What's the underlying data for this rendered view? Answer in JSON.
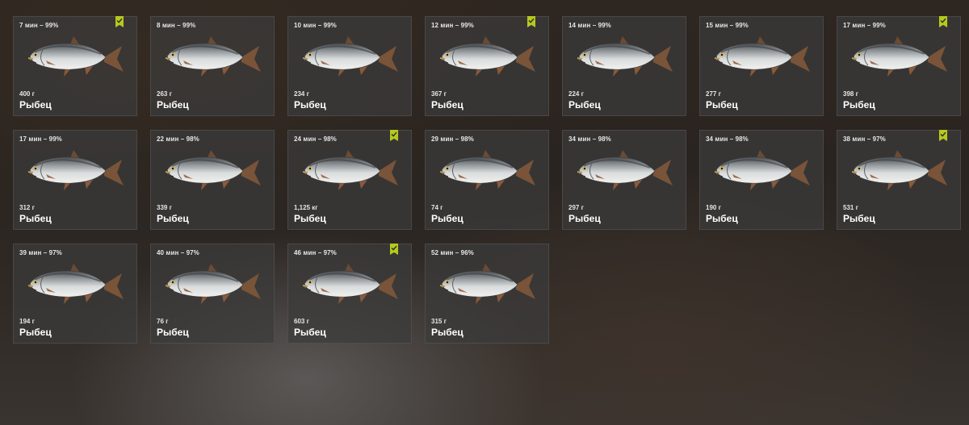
{
  "colors": {
    "badge": "#b6c91d",
    "card_background": "#3c3c3c",
    "text": "#ffffff"
  },
  "catches": [
    {
      "time": "7 мин – 99%",
      "weight": "400 г",
      "name": "Рыбец",
      "marked": true
    },
    {
      "time": "8 мин – 99%",
      "weight": "263 г",
      "name": "Рыбец",
      "marked": false
    },
    {
      "time": "10 мин – 99%",
      "weight": "234 г",
      "name": "Рыбец",
      "marked": false
    },
    {
      "time": "12 мин – 99%",
      "weight": "367 г",
      "name": "Рыбец",
      "marked": true
    },
    {
      "time": "14 мин – 99%",
      "weight": "224 г",
      "name": "Рыбец",
      "marked": false
    },
    {
      "time": "15 мин – 99%",
      "weight": "277 г",
      "name": "Рыбец",
      "marked": false
    },
    {
      "time": "17 мин – 99%",
      "weight": "398 г",
      "name": "Рыбец",
      "marked": true
    },
    {
      "time": "17 мин – 99%",
      "weight": "312 г",
      "name": "Рыбец",
      "marked": false
    },
    {
      "time": "22 мин – 98%",
      "weight": "339 г",
      "name": "Рыбец",
      "marked": false
    },
    {
      "time": "24 мин – 98%",
      "weight": "1,125 кг",
      "name": "Рыбец",
      "marked": true
    },
    {
      "time": "29 мин – 98%",
      "weight": "74 г",
      "name": "Рыбец",
      "marked": false
    },
    {
      "time": "34 мин – 98%",
      "weight": "297 г",
      "name": "Рыбец",
      "marked": false
    },
    {
      "time": "34 мин – 98%",
      "weight": "190 г",
      "name": "Рыбец",
      "marked": false
    },
    {
      "time": "38 мин – 97%",
      "weight": "531 г",
      "name": "Рыбец",
      "marked": true
    },
    {
      "time": "39 мин – 97%",
      "weight": "194 г",
      "name": "Рыбец",
      "marked": false
    },
    {
      "time": "40 мин – 97%",
      "weight": "76 г",
      "name": "Рыбец",
      "marked": false
    },
    {
      "time": "46 мин – 97%",
      "weight": "603 г",
      "name": "Рыбец",
      "marked": true
    },
    {
      "time": "52 мин – 96%",
      "weight": "315 г",
      "name": "Рыбец",
      "marked": false
    }
  ]
}
